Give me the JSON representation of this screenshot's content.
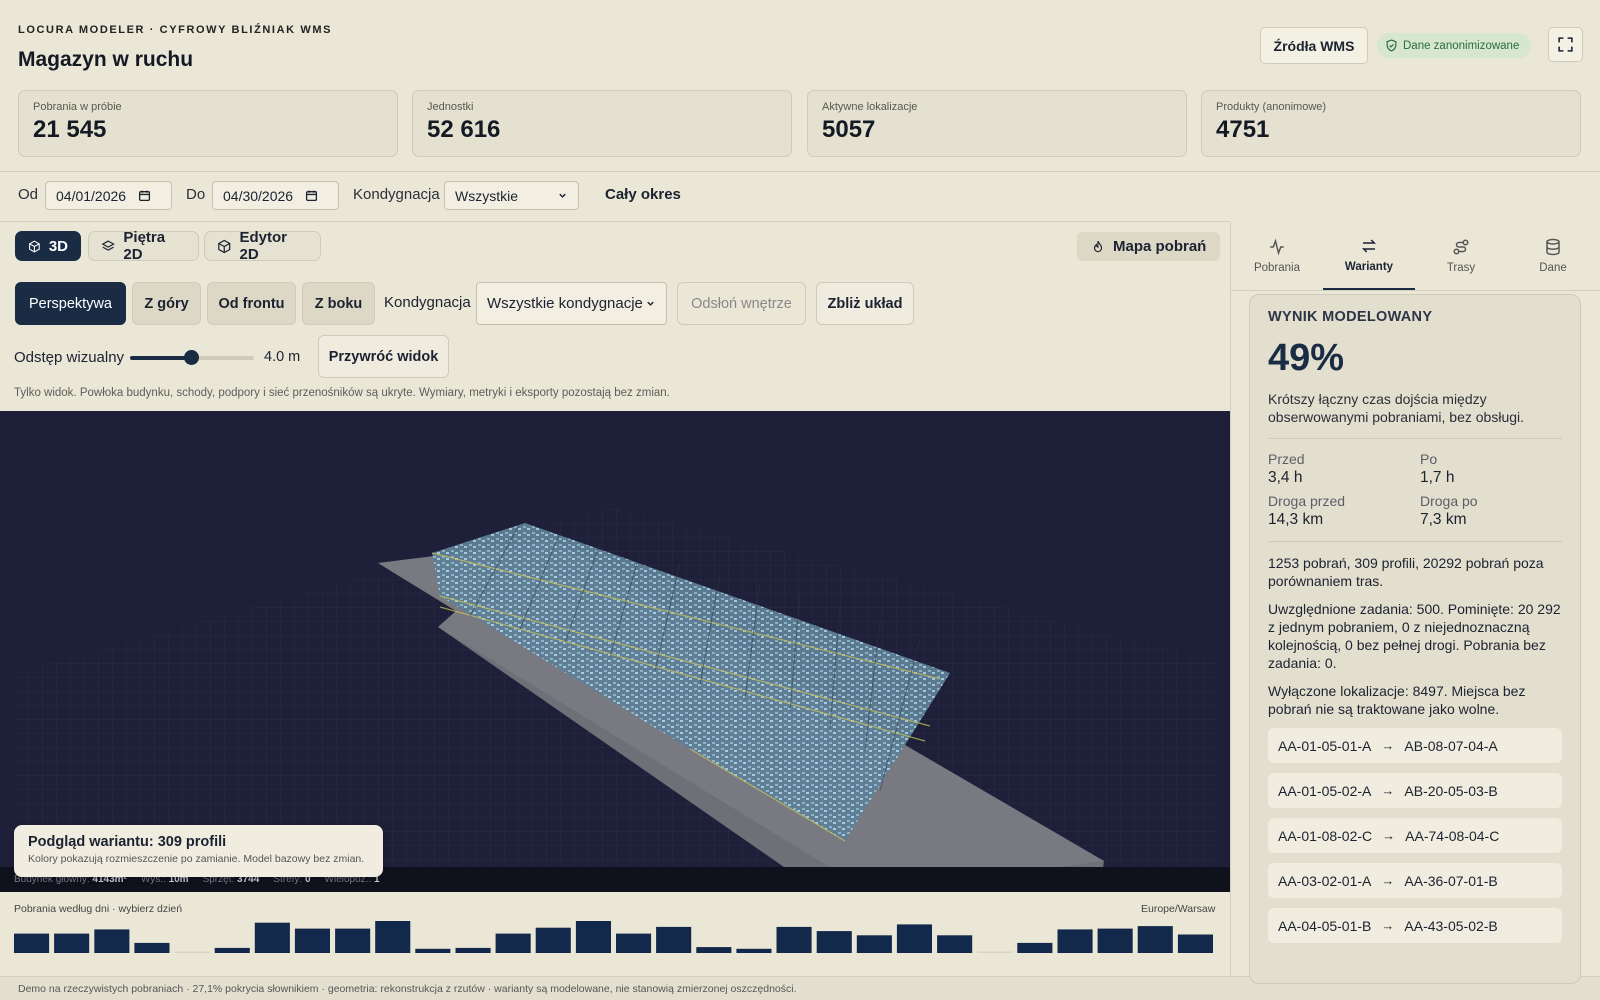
{
  "header": {
    "eyebrow": "LOCURA MODELER · CYFROWY BLIŹNIAK WMS",
    "title": "Magazyn w ruchu",
    "wms_button": "Źródła WMS",
    "anon_badge": "Dane zanonimizowane"
  },
  "stats": [
    {
      "label": "Pobrania w próbie",
      "value": "21 545"
    },
    {
      "label": "Jednostki",
      "value": "52 616"
    },
    {
      "label": "Aktywne lokalizacje",
      "value": "5057"
    },
    {
      "label": "Produkty (anonimowe)",
      "value": "4751"
    }
  ],
  "filters": {
    "from_label": "Od",
    "from_value": "04/01/2026",
    "to_label": "Do",
    "to_value": "04/30/2026",
    "level_label": "Kondygnacja",
    "level_value": "Wszystkie",
    "full_period": "Cały okres"
  },
  "viewer_tabs": [
    {
      "label": "3D",
      "icon": "cube-icon",
      "active": true
    },
    {
      "label": "Piętra 2D",
      "icon": "layers-icon",
      "active": false
    },
    {
      "label": "Edytor 2D",
      "icon": "box-icon",
      "active": false
    }
  ],
  "heatmap_button": "Mapa pobrań",
  "camera": {
    "views": [
      "Perspektywa",
      "Z góry",
      "Od frontu",
      "Z boku"
    ],
    "active": "Perspektywa",
    "level_label": "Kondygnacja",
    "level_value": "Wszystkie kondygnacje",
    "reveal_button": "Odsłoń wnętrze",
    "fit_button": "Zbliż układ"
  },
  "spacing": {
    "label": "Odstęp wizualny",
    "value": "4.0 m",
    "level_fraction": 0.5,
    "reset_button": "Przywróć widok"
  },
  "viewer_note": "Tylko widok. Powłoka budynku, schody, podpory i sieć przenośników są ukryte. Wymiary, metryki i eksporty pozostają bez zmian.",
  "variant_preview": {
    "title": "Podgląd wariantu: 309 profili",
    "subtitle": "Kolory pokazują rozmieszczenie po zamianie. Model bazowy bez zmian."
  },
  "viewer_stats": [
    {
      "label": "Budynek główny:",
      "value": "4143m²"
    },
    {
      "label": "Wys.:",
      "value": "10m"
    },
    {
      "label": "Sprzęt:",
      "value": "3744"
    },
    {
      "label": "Strefy:",
      "value": "0"
    },
    {
      "label": "Wielopoz.:",
      "value": "1"
    }
  ],
  "daily": {
    "title": "Pobrania według dni · wybierz dzień",
    "timezone": "Europe/Warsaw"
  },
  "chart_data": {
    "type": "bar",
    "values": [
      23,
      23,
      28,
      12,
      0,
      6,
      36,
      29,
      29,
      38,
      5,
      6,
      23,
      30,
      38,
      23,
      31,
      7,
      5,
      31,
      26,
      21,
      34,
      21,
      0,
      12,
      28,
      29,
      32,
      22
    ],
    "color": "#13294b"
  },
  "right_tabs": [
    {
      "label": "Pobrania",
      "icon": "activity-icon",
      "active": false
    },
    {
      "label": "Warianty",
      "icon": "swap-icon",
      "active": true
    },
    {
      "label": "Trasy",
      "icon": "route-icon",
      "active": false
    },
    {
      "label": "Dane",
      "icon": "database-icon",
      "active": false
    }
  ],
  "result": {
    "label": "WYNIK MODELOWANY",
    "value": "49%",
    "description": "Krótszy łączny czas dojścia między obserwowanymi pobraniami, bez obsługi.",
    "before_label": "Przed",
    "before_value": "3,4 h",
    "after_label": "Po",
    "after_value": "1,7 h",
    "dist_before_label": "Droga przed",
    "dist_before_value": "14,3 km",
    "dist_after_label": "Droga po",
    "dist_after_value": "7,3 km",
    "para1": "1253 pobrań, 309 profili, 20292 pobrań poza porównaniem tras.",
    "para2": "Uwzględnione zadania: 500. Pominięte: 20 292 z jednym pobraniem, 0 z niejednoznaczną kolejnością, 0 bez pełnej drogi. Pobrania bez zadania: 0.",
    "para3": "Wyłączone lokalizacje: 8497. Miejsca bez pobrań nie są traktowane jako wolne.",
    "moves": [
      {
        "from": "AA-01-05-01-A",
        "to": "AB-08-07-04-A"
      },
      {
        "from": "AA-01-05-02-A",
        "to": "AB-20-05-03-B"
      },
      {
        "from": "AA-01-08-02-C",
        "to": "AA-74-08-04-C"
      },
      {
        "from": "AA-03-02-01-A",
        "to": "AA-36-07-01-B"
      },
      {
        "from": "AA-04-05-01-B",
        "to": "AA-43-05-02-B"
      }
    ]
  },
  "footer": "Demo na rzeczywistych pobraniach · 27,1% pokrycia słownikiem · geometria: rekonstrukcja z rzutów · warianty są modelowane, nie stanowią zmierzonej oszczędności.",
  "colors": {
    "accent": "#1a2b44",
    "background": "#ebe7d7",
    "viewport": "#1e1f38",
    "badge": "#2b6d3c"
  }
}
